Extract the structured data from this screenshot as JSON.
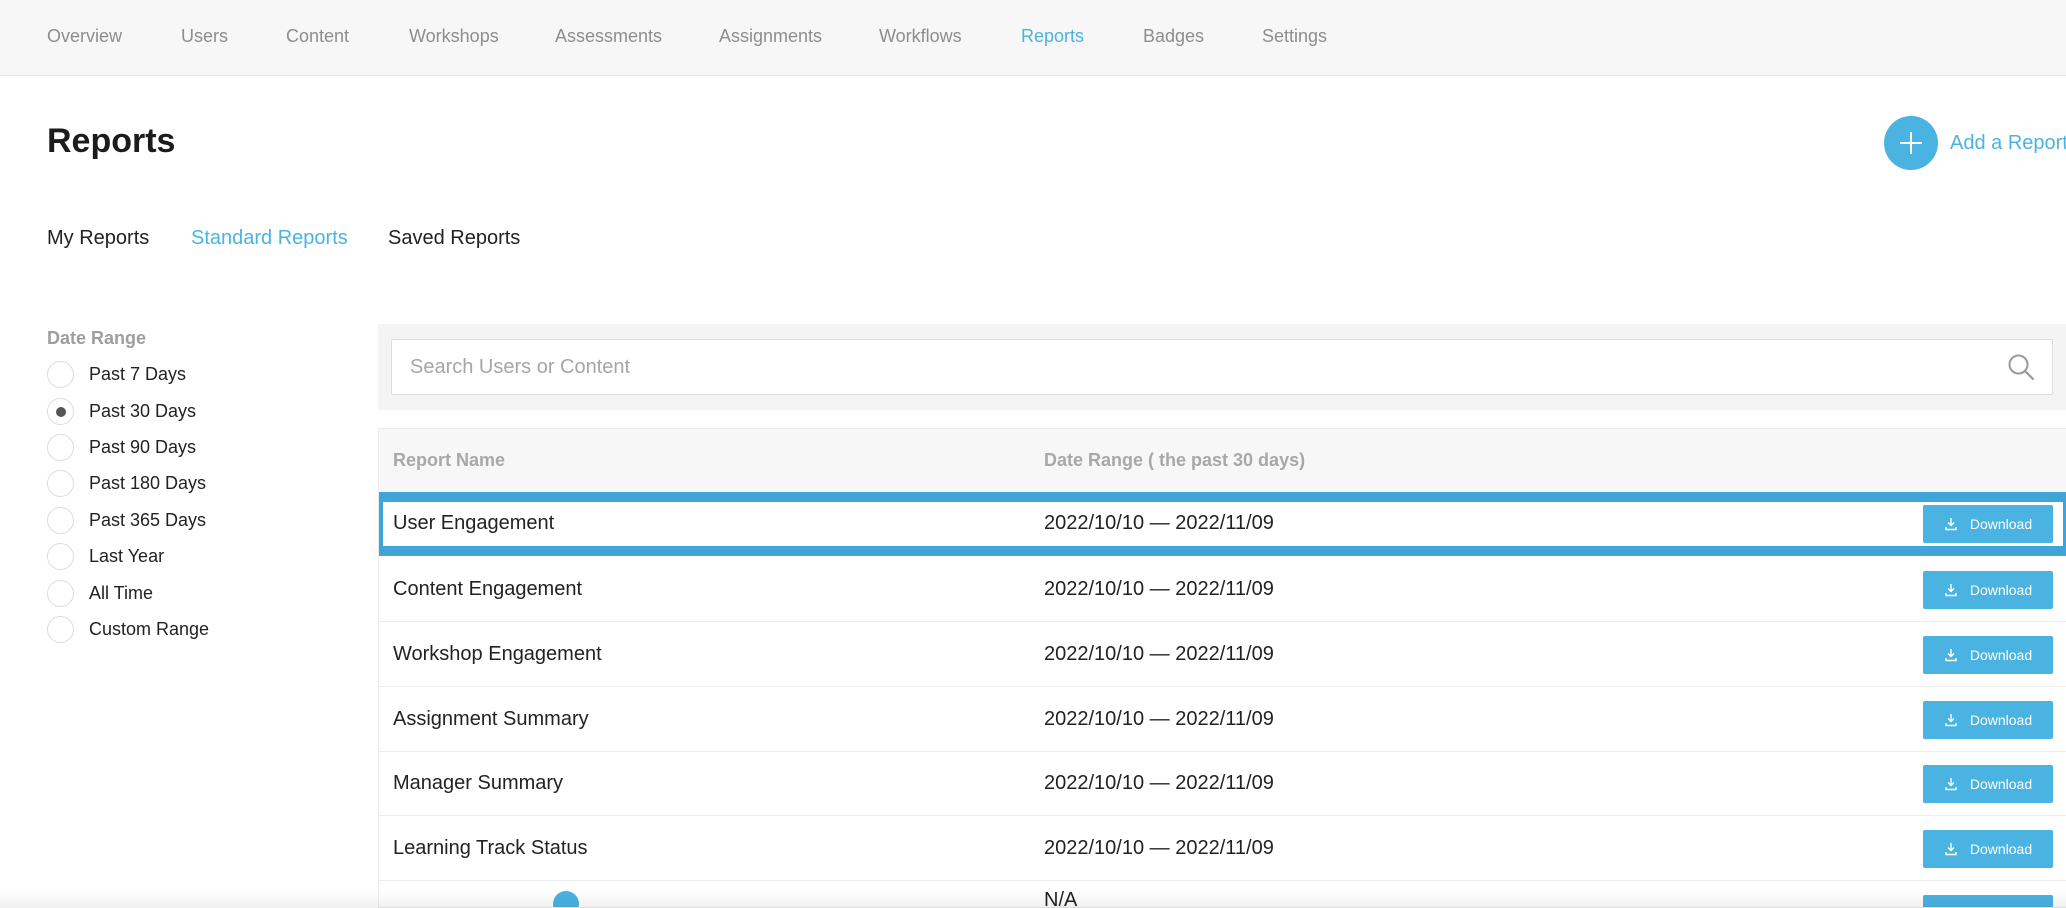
{
  "nav": {
    "items": [
      {
        "label": "Overview",
        "active": false
      },
      {
        "label": "Users",
        "active": false
      },
      {
        "label": "Content",
        "active": false
      },
      {
        "label": "Workshops",
        "active": false
      },
      {
        "label": "Assessments",
        "active": false
      },
      {
        "label": "Assignments",
        "active": false
      },
      {
        "label": "Workflows",
        "active": false
      },
      {
        "label": "Reports",
        "active": true
      },
      {
        "label": "Badges",
        "active": false
      },
      {
        "label": "Settings",
        "active": false
      }
    ]
  },
  "page": {
    "title": "Reports",
    "add_label": "Add a Report"
  },
  "subtabs": [
    {
      "label": "My Reports",
      "active": false
    },
    {
      "label": "Standard Reports",
      "active": true
    },
    {
      "label": "Saved Reports",
      "active": false
    }
  ],
  "filters": {
    "title": "Date Range",
    "options": [
      {
        "label": "Past 7 Days",
        "checked": false
      },
      {
        "label": "Past 30 Days",
        "checked": true
      },
      {
        "label": "Past 90 Days",
        "checked": false
      },
      {
        "label": "Past 180 Days",
        "checked": false
      },
      {
        "label": "Past 365 Days",
        "checked": false
      },
      {
        "label": "Last Year",
        "checked": false
      },
      {
        "label": "All Time",
        "checked": false
      },
      {
        "label": "Custom Range",
        "checked": false
      }
    ]
  },
  "search": {
    "placeholder": "Search Users or Content",
    "value": ""
  },
  "table": {
    "columns": [
      "Report Name",
      "Date Range ( the past 30 days)"
    ],
    "download_label": "Download",
    "rows": [
      {
        "name": "User Engagement",
        "date_range": "2022/10/10 — 2022/11/09",
        "selected": true
      },
      {
        "name": "Content Engagement",
        "date_range": "2022/10/10 — 2022/11/09",
        "selected": false
      },
      {
        "name": "Workshop Engagement",
        "date_range": "2022/10/10 — 2022/11/09",
        "selected": false
      },
      {
        "name": "Assignment Summary",
        "date_range": "2022/10/10 — 2022/11/09",
        "selected": false
      },
      {
        "name": "Manager Summary",
        "date_range": "2022/10/10 — 2022/11/09",
        "selected": false
      },
      {
        "name": "Learning Track Status",
        "date_range": "2022/10/10 — 2022/11/09",
        "selected": false
      }
    ],
    "partial_row_text": "N/A"
  },
  "colors": {
    "accent": "#4ab3e2",
    "selection_border": "#3fa5d8",
    "nav_background": "#f7f7f7"
  },
  "icons": {
    "add": "plus-icon",
    "search": "search-icon",
    "download": "download-icon"
  }
}
